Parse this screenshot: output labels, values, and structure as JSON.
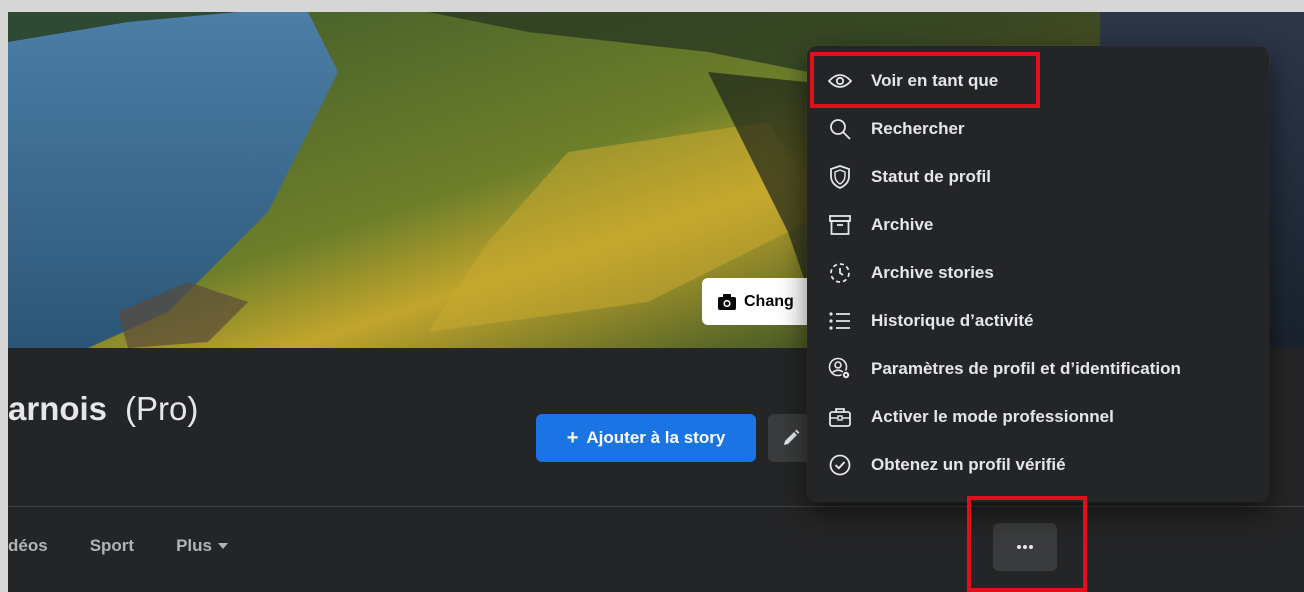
{
  "cover": {
    "change_cover_label": "Chang"
  },
  "profile": {
    "name_fragment": "arnois",
    "suffix": "(Pro)"
  },
  "actions": {
    "add_story_label": "Ajouter à la story",
    "add_story_icon": "plus-icon",
    "edit_icon": "pencil-icon",
    "more_icon": "ellipsis-icon"
  },
  "tabs": [
    {
      "label": "déos"
    },
    {
      "label": "Sport"
    },
    {
      "label": "Plus",
      "icon": "caret-down-icon"
    }
  ],
  "menu": {
    "items": [
      {
        "label": "Voir en tant que",
        "icon": "eye-icon"
      },
      {
        "label": "Rechercher",
        "icon": "search-icon"
      },
      {
        "label": "Statut de profil",
        "icon": "shield-icon"
      },
      {
        "label": "Archive",
        "icon": "archive-box-icon"
      },
      {
        "label": "Archive stories",
        "icon": "clock-history-icon"
      },
      {
        "label": "Historique d’activité",
        "icon": "list-icon"
      },
      {
        "label": "Paramètres de profil et d’identification",
        "icon": "user-gear-icon"
      },
      {
        "label": "Activer le mode professionnel",
        "icon": "briefcase-icon"
      },
      {
        "label": "Obtenez un profil vérifié",
        "icon": "verified-check-icon"
      }
    ]
  },
  "colors": {
    "highlight": "#e0101b",
    "primary_button": "#1b74e4",
    "background": "#242526"
  }
}
